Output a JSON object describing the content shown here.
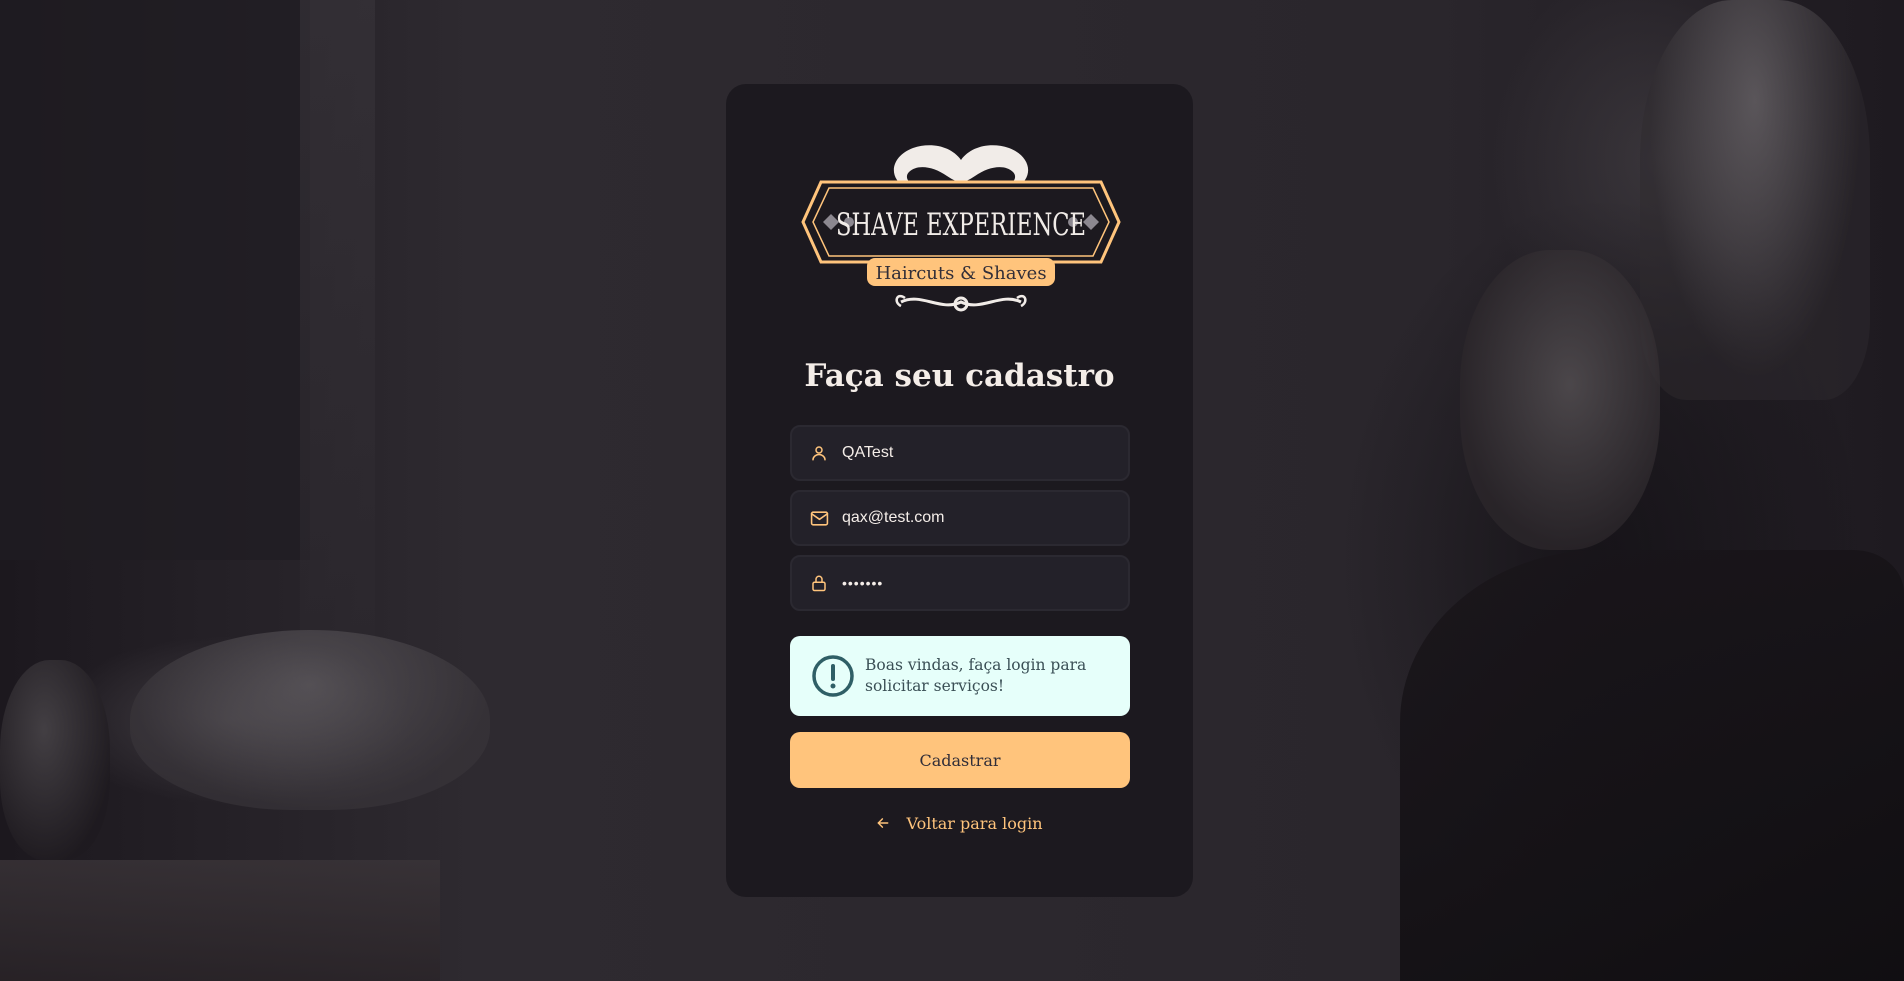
{
  "brand": {
    "name": "SHAVE EXPERIENCE",
    "tagline": "Haircuts & Shaves"
  },
  "page": {
    "title": "Faça seu cadastro"
  },
  "form": {
    "name": {
      "icon": "user-icon",
      "value": "QATest"
    },
    "email": {
      "icon": "mail-icon",
      "value": "qax@test.com"
    },
    "password": {
      "icon": "lock-icon",
      "value": "•••••••"
    }
  },
  "alert": {
    "icon": "alert-circle-icon",
    "message": "Boas vindas, faça login para solicitar serviços!"
  },
  "submit": {
    "label": "Cadastrar"
  },
  "back_link": {
    "icon": "arrow-left-icon",
    "label": "Voltar para login"
  },
  "colors": {
    "accent": "#ffc47c",
    "card": "#1c191f",
    "input": "#232129",
    "alert_bg": "#e6fffa",
    "text": "#f4ede8"
  }
}
